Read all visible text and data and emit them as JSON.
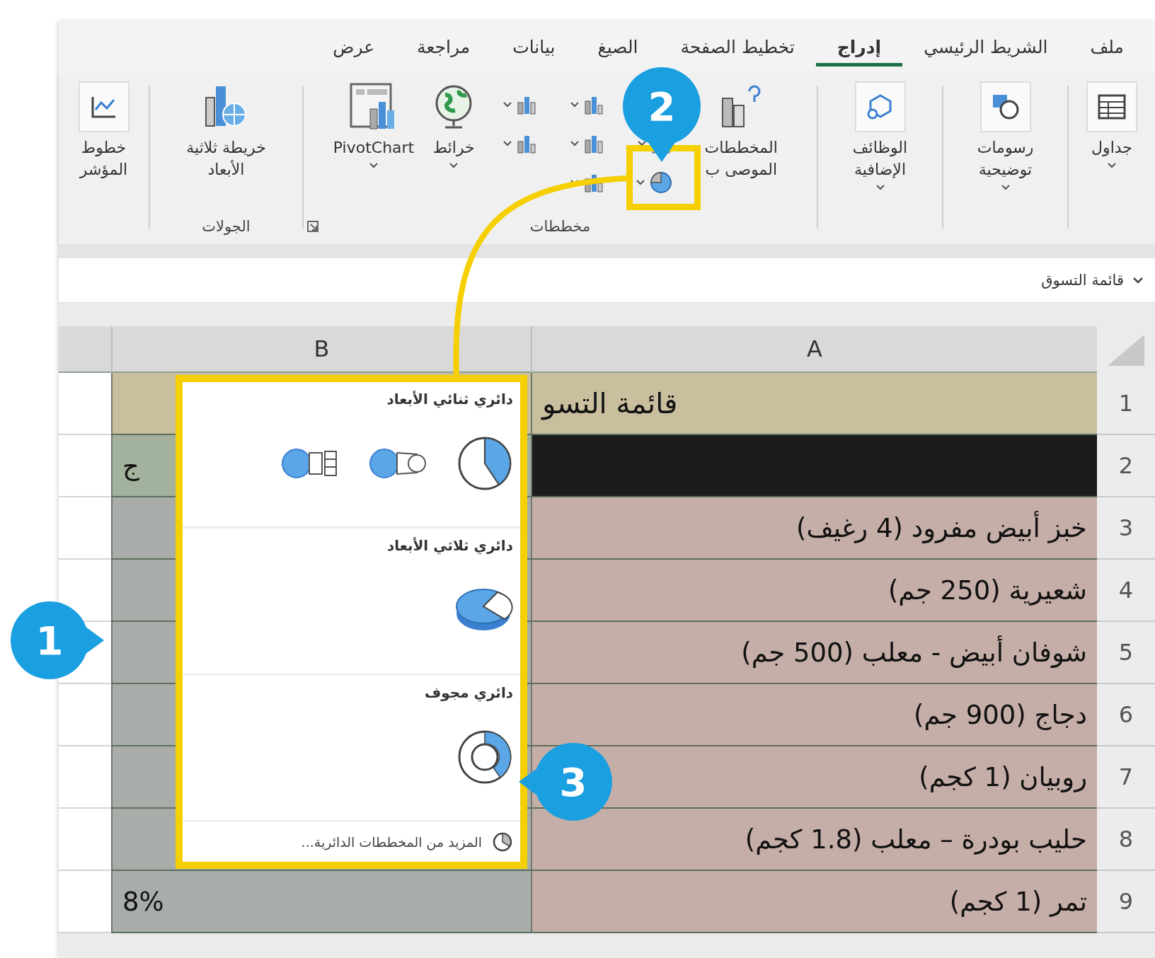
{
  "tabs": [
    {
      "label": "ملف",
      "selected": false
    },
    {
      "label": "الشريط الرئيسي",
      "selected": false
    },
    {
      "label": "إدراج",
      "selected": true
    },
    {
      "label": "تخطيط الصفحة",
      "selected": false
    },
    {
      "label": "الصيغ",
      "selected": false
    },
    {
      "label": "بيانات",
      "selected": false
    },
    {
      "label": "مراجعة",
      "selected": false
    },
    {
      "label": "عرض",
      "selected": false
    }
  ],
  "ribbon": {
    "right_buttons": [
      {
        "label": "جداول"
      },
      {
        "label": "رسومات توضيحية"
      },
      {
        "label": "الوظائف الإضافية"
      }
    ],
    "recommended": "المخططات الموصى ب",
    "maps": "خرائط",
    "pivot": "PivotChart",
    "charts_group": "مخططات",
    "map3d": "خريطة ثلاثية الأبعاد",
    "tours_group": "الجولات",
    "sparklines": "خطوط المؤشر"
  },
  "name_box": "قائمة التسوق",
  "columns": [
    "A",
    "B"
  ],
  "rows": [
    {
      "number": "1",
      "kind": "title",
      "a": "قائمة التسو"
    },
    {
      "number": "2",
      "kind": "header",
      "b": "ج"
    },
    {
      "number": "3",
      "kind": "item",
      "a": "خبز أبيض مفرود (4 رغيف)"
    },
    {
      "number": "4",
      "kind": "item",
      "a": "شعيرية (250 جم)"
    },
    {
      "number": "5",
      "kind": "item",
      "a": "شوفان أبيض - معلب (500 جم)"
    },
    {
      "number": "6",
      "kind": "item",
      "a": "دجاج (900 جم)"
    },
    {
      "number": "7",
      "kind": "item",
      "a": "روبيان (1 كجم)"
    },
    {
      "number": "8",
      "kind": "item",
      "a": "حليب بودرة – معلب (1.8 كجم)"
    },
    {
      "number": "9",
      "kind": "item",
      "a": "تمر (1 كجم)",
      "b": "8%"
    }
  ],
  "pie_menu": {
    "sections": [
      {
        "title": "دائري ثنائي الأبعاد"
      },
      {
        "title": "دائري ثلاثي الأبعاد"
      },
      {
        "title": "دائري مجوف"
      }
    ],
    "more": "المزيد من المخططات الدائرية..."
  },
  "callouts": [
    "1",
    "2",
    "3"
  ]
}
